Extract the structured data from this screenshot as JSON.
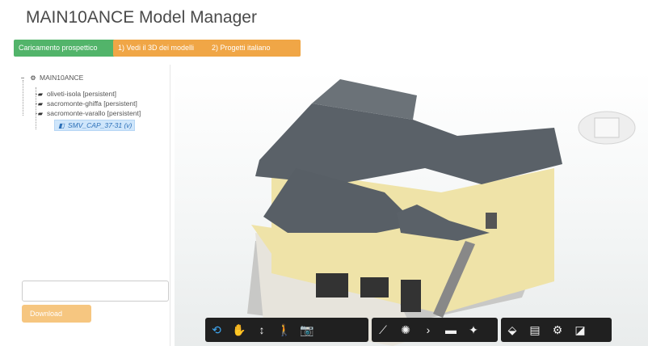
{
  "app": {
    "title": "MAIN10ANCE Model Manager"
  },
  "toolbar_buttons": {
    "green": "Caricamento prospettico",
    "orange1": "1) Vedi il 3D dei modelli",
    "orange2": "2) Progetti italiano"
  },
  "tree": {
    "root": "MAIN10ANCE",
    "items": [
      {
        "label": "oliveti-isola [persistent]"
      },
      {
        "label": "sacromonte-ghiffa [persistent]"
      },
      {
        "label": "sacromonte-varallo [persistent]"
      }
    ],
    "selected_child": "SMV_CAP_37-31 (v)"
  },
  "panel": {
    "filter_placeholder": "",
    "download_label": "Download"
  },
  "viewer": {
    "tools_left": [
      "orbit-icon",
      "pan-icon",
      "dolly-icon",
      "walk-icon",
      "camera-icon"
    ],
    "tools_mid": [
      "measure-icon",
      "explode-icon",
      "section-icon",
      "folder-icon",
      "model-browser-icon"
    ],
    "tools_right": [
      "structure-icon",
      "properties-icon",
      "settings-icon",
      "fullscreen-icon"
    ]
  },
  "colors": {
    "accent_green": "#52b46a",
    "accent_orange": "#f0a646",
    "toolbar": "#202020",
    "roof": "#5a6168",
    "walls": "#efe3a8"
  }
}
